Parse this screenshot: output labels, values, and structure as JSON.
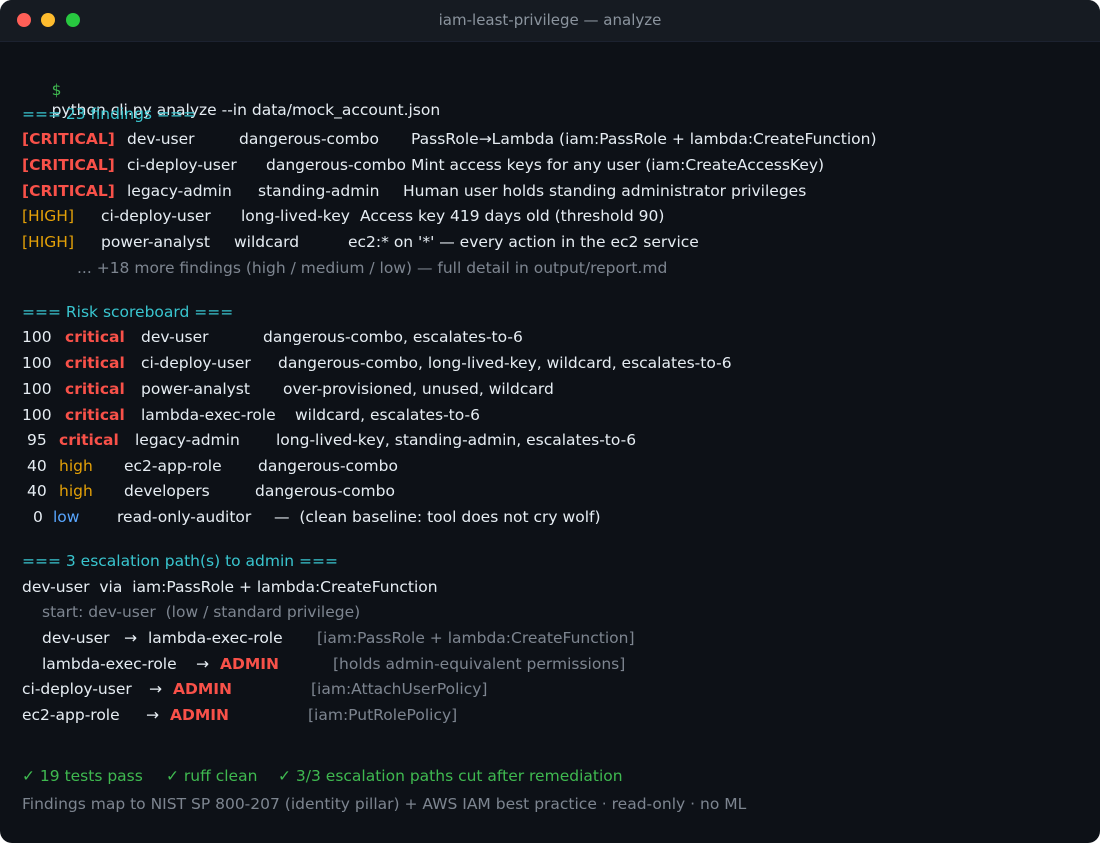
{
  "window": {
    "title": "iam-least-privilege — analyze"
  },
  "prompt": {
    "symbol": "$",
    "command": "python cli.py analyze --in data/mock_account.json"
  },
  "findings": {
    "header": "=== 23 findings ===",
    "rows": [
      {
        "severity": "[CRITICAL]",
        "principal": "dev-user",
        "rule": "dangerous-combo",
        "detail": "PassRole→Lambda (iam:PassRole + lambda:CreateFunction)"
      },
      {
        "severity": "[CRITICAL]",
        "principal": "ci-deploy-user",
        "rule": "dangerous-combo",
        "detail": "Mint access keys for any user (iam:CreateAccessKey)"
      },
      {
        "severity": "[CRITICAL]",
        "principal": "legacy-admin",
        "rule": "standing-admin",
        "detail": "Human user holds standing administrator privileges"
      },
      {
        "severity": "[HIGH]",
        "principal": "ci-deploy-user",
        "rule": "long-lived-key",
        "detail": "Access key 419 days old (threshold 90)"
      },
      {
        "severity": "[HIGH]",
        "principal": "power-analyst",
        "rule": "wildcard",
        "detail": "ec2:* on '*' — every action in the ec2 service"
      }
    ],
    "more": "... +18 more findings (high / medium / low) — full detail in output/report.md"
  },
  "scoreboard": {
    "header": "=== Risk scoreboard ===",
    "rows": [
      {
        "score": "100",
        "level": "critical",
        "principal": "dev-user",
        "tags": "dangerous-combo, escalates-to-6"
      },
      {
        "score": "100",
        "level": "critical",
        "principal": "ci-deploy-user",
        "tags": "dangerous-combo, long-lived-key, wildcard, escalates-to-6"
      },
      {
        "score": "100",
        "level": "critical",
        "principal": "power-analyst",
        "tags": "over-provisioned, unused, wildcard"
      },
      {
        "score": "100",
        "level": "critical",
        "principal": "lambda-exec-role",
        "tags": "wildcard, escalates-to-6"
      },
      {
        "score": "95",
        "level": "critical",
        "principal": "legacy-admin",
        "tags": "long-lived-key, standing-admin, escalates-to-6"
      },
      {
        "score": "40",
        "level": "high",
        "principal": "ec2-app-role",
        "tags": "dangerous-combo"
      },
      {
        "score": "40",
        "level": "high",
        "principal": "developers",
        "tags": "dangerous-combo"
      },
      {
        "score": "0",
        "level": "low",
        "principal": "read-only-auditor",
        "tags": "—  (clean baseline: tool does not cry wolf)"
      }
    ]
  },
  "escalation": {
    "header": "=== 3 escalation path(s) to admin ===",
    "path1_title": "dev-user  via  iam:PassRole + lambda:CreateFunction",
    "path1_start": "start: dev-user  (low / standard privilege)",
    "path1_step1_from": "dev-user",
    "path1_step1_to": "lambda-exec-role",
    "path1_step1_reason": "[iam:PassRole + lambda:CreateFunction]",
    "path1_step2_from": "lambda-exec-role",
    "path1_step2_to": "ADMIN",
    "path1_step2_reason": "[holds admin-equivalent permissions]",
    "path2_from": "ci-deploy-user",
    "path2_to": "ADMIN",
    "path2_reason": "[iam:AttachUserPolicy]",
    "path3_from": "ec2-app-role",
    "path3_to": "ADMIN",
    "path3_reason": "[iam:PutRolePolicy]",
    "arrow": "→"
  },
  "summary": {
    "tests": "✓ 19 tests pass",
    "ruff": "✓ ruff clean",
    "paths": "✓ 3/3 escalation paths cut after remediation",
    "footer": "Findings map to NIST SP 800-207 (identity pillar) + AWS IAM best practice · read-only · no ML"
  },
  "colors": {
    "background": "#0d1117",
    "critical": "#f85149",
    "high": "#e3a008",
    "low": "#58a6ff",
    "header": "#39c5cf",
    "pass": "#3fb950",
    "muted": "#7d8590"
  }
}
